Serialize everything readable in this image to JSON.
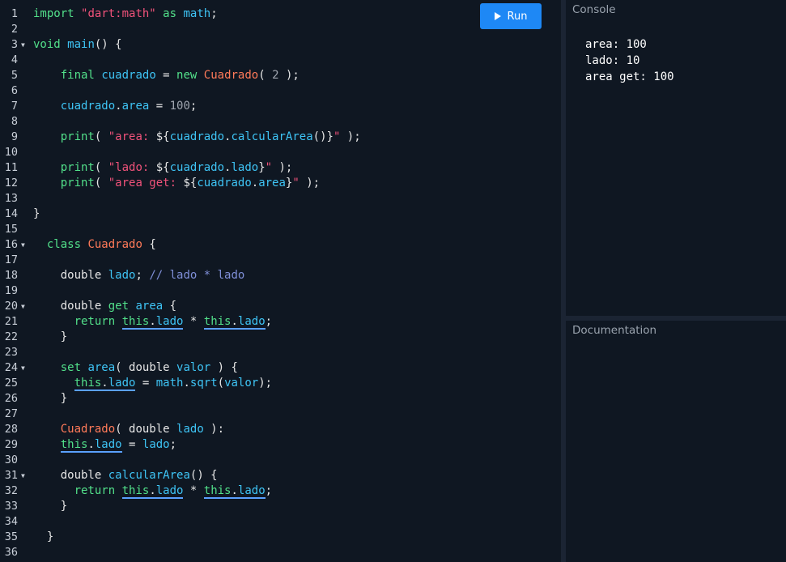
{
  "run_button": {
    "label": "Run"
  },
  "console": {
    "title": "Console",
    "output": [
      "area: 100",
      "lado: 10",
      "area get: 100"
    ]
  },
  "documentation": {
    "title": "Documentation"
  },
  "editor": {
    "line_numbers": [
      "1",
      "2",
      "3",
      "4",
      "5",
      "6",
      "7",
      "8",
      "9",
      "10",
      "11",
      "12",
      "13",
      "14",
      "15",
      "16",
      "17",
      "18",
      "19",
      "20",
      "21",
      "22",
      "23",
      "24",
      "25",
      "26",
      "27",
      "28",
      "29",
      "30",
      "31",
      "32",
      "33",
      "34",
      "35",
      "36"
    ],
    "lines": [
      "import \"dart:math\" as math;",
      "",
      "void main() {",
      "",
      "    final cuadrado = new Cuadrado( 2 );",
      "",
      "    cuadrado.area = 100;",
      "",
      "    print( \"area: ${cuadrado.calcularArea()}\" );",
      "",
      "    print( \"lado: ${cuadrado.lado}\" );",
      "    print( \"area get: ${cuadrado.area}\" );",
      "",
      "}",
      "",
      "  class Cuadrado {",
      "",
      "    double lado; // lado * lado",
      "",
      "    double get area {",
      "      return this.lado * this.lado;",
      "    }",
      "",
      "    set area( double valor ) {",
      "      this.lado = math.sqrt(valor);",
      "    }",
      "",
      "    Cuadrado( double lado ):",
      "    this.lado = lado;",
      "",
      "    double calcularArea() {",
      "      return this.lado * this.lado;",
      "    }",
      "",
      "  }",
      ""
    ]
  },
  "colors": {
    "keyword": "#52e08a",
    "identifier": "#3ec4f5",
    "string": "#f0527a",
    "class": "#ff7a59",
    "comment": "#7f8fd8",
    "run_button": "#1e88f5"
  }
}
